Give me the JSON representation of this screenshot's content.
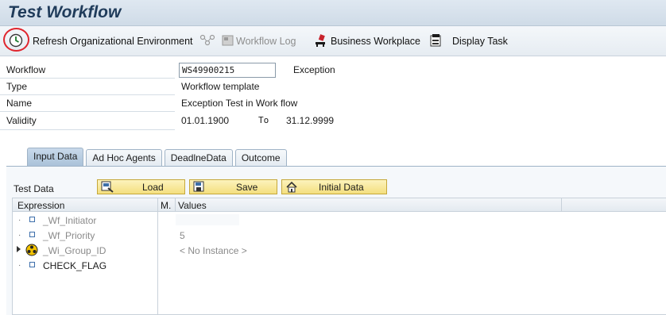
{
  "title": "Test Workflow",
  "toolbar": {
    "refresh_label": "Refresh Organizational Environment",
    "workflow_log_label": "Workflow Log",
    "business_workplace_label": "Business Workplace",
    "display_task_label": "Display Task"
  },
  "form": {
    "workflow_label": "Workflow",
    "workflow_value": "WS49900215",
    "workflow_status": "Exception",
    "type_label": "Type",
    "type_value": "Workflow template",
    "name_label": "Name",
    "name_value": "Exception Test in Work flow",
    "validity_label": "Validity",
    "validity_from": "01.01.1900",
    "validity_to_label": "To",
    "validity_to": "31.12.9999"
  },
  "tabs": [
    {
      "label": "Input Data",
      "active": true
    },
    {
      "label": "Ad Hoc Agents",
      "active": false
    },
    {
      "label": "DeadlneData",
      "active": false
    },
    {
      "label": "Outcome",
      "active": false
    }
  ],
  "test_data": {
    "label": "Test Data",
    "load_label": "Load",
    "save_label": "Save",
    "initial_data_label": "Initial Data"
  },
  "grid": {
    "col_expression": "Expression",
    "col_m": "M.",
    "col_values": "Values",
    "rows": [
      {
        "name": "_Wf_Initiator",
        "value": "",
        "icon": "leaf-icon",
        "disabled": true
      },
      {
        "name": "_Wf_Priority",
        "value": "5",
        "icon": "leaf-icon",
        "disabled": true
      },
      {
        "name": "_Wi_Group_ID",
        "value": "< No Instance >",
        "icon": "object-instance-icon",
        "disabled": true
      },
      {
        "name": "CHECK_FLAG",
        "value": "",
        "icon": "leaf-icon",
        "disabled": false
      }
    ]
  },
  "colors": {
    "title": "#1f3b5a",
    "highlight_circle": "#e0262e",
    "button_fill": "#f4df7e",
    "active_tab": "#a9c1d8"
  }
}
